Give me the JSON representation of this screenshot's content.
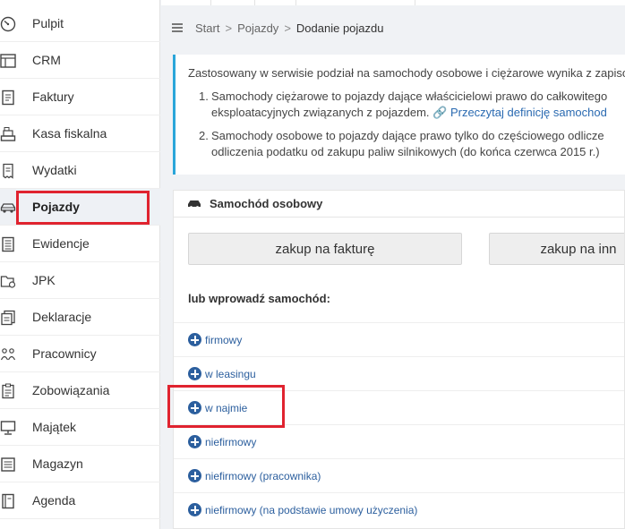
{
  "sidebar": {
    "items": [
      {
        "label": "Pulpit",
        "icon": "gauge-icon"
      },
      {
        "label": "CRM",
        "icon": "crm-board-icon"
      },
      {
        "label": "Faktury",
        "icon": "invoice-icon"
      },
      {
        "label": "Kasa fiskalna",
        "icon": "cash-register-icon"
      },
      {
        "label": "Wydatki",
        "icon": "receipt-icon"
      },
      {
        "label": "Pojazdy",
        "icon": "car-icon",
        "active": true
      },
      {
        "label": "Ewidencje",
        "icon": "register-icon"
      },
      {
        "label": "JPK",
        "icon": "jpk-folder-icon"
      },
      {
        "label": "Deklaracje",
        "icon": "declaration-icon"
      },
      {
        "label": "Pracownicy",
        "icon": "employees-icon"
      },
      {
        "label": "Zobowiązania",
        "icon": "clipboard-icon"
      },
      {
        "label": "Majątek",
        "icon": "monitor-icon"
      },
      {
        "label": "Magazyn",
        "icon": "warehouse-icon"
      },
      {
        "label": "Agenda",
        "icon": "agenda-icon"
      }
    ]
  },
  "breadcrumb": {
    "items": [
      "Start",
      "Pojazdy",
      "Dodanie pojazdu"
    ],
    "separator": ">"
  },
  "info": {
    "intro": "Zastosowany w serwisie podział na samochody osobowe i ciężarowe wynika z zapiso",
    "points": [
      {
        "num": "1.",
        "line1": "Samochody ciężarowe to pojazdy dające właścicielowi prawo do całkowitego",
        "line2": "eksploatacyjnych związanych z pojazdem.",
        "link": "Przeczytaj definicję samochod"
      },
      {
        "num": "2.",
        "line1": "Samochody osobowe to pojazdy dające prawo tylko do częściowego odlicze",
        "line2": "odliczenia podatku od zakupu paliw silnikowych (do końca czerwca 2015 r.)"
      }
    ],
    "accent_color": "#2aa5d9"
  },
  "panel": {
    "title": "Samochód osobowy",
    "buttons": [
      "zakup na fakturę",
      "zakup na inn"
    ],
    "or_label": "lub wprowadź samochód:",
    "options": [
      "firmowy",
      "w leasingu",
      "w najmie",
      "niefirmowy",
      "niefirmowy (pracownika)",
      "niefirmowy (na podstawie umowy użyczenia)"
    ]
  },
  "colors": {
    "highlight": "#e0232f",
    "link": "#2c5f9e",
    "accent": "#2aa5d9"
  }
}
